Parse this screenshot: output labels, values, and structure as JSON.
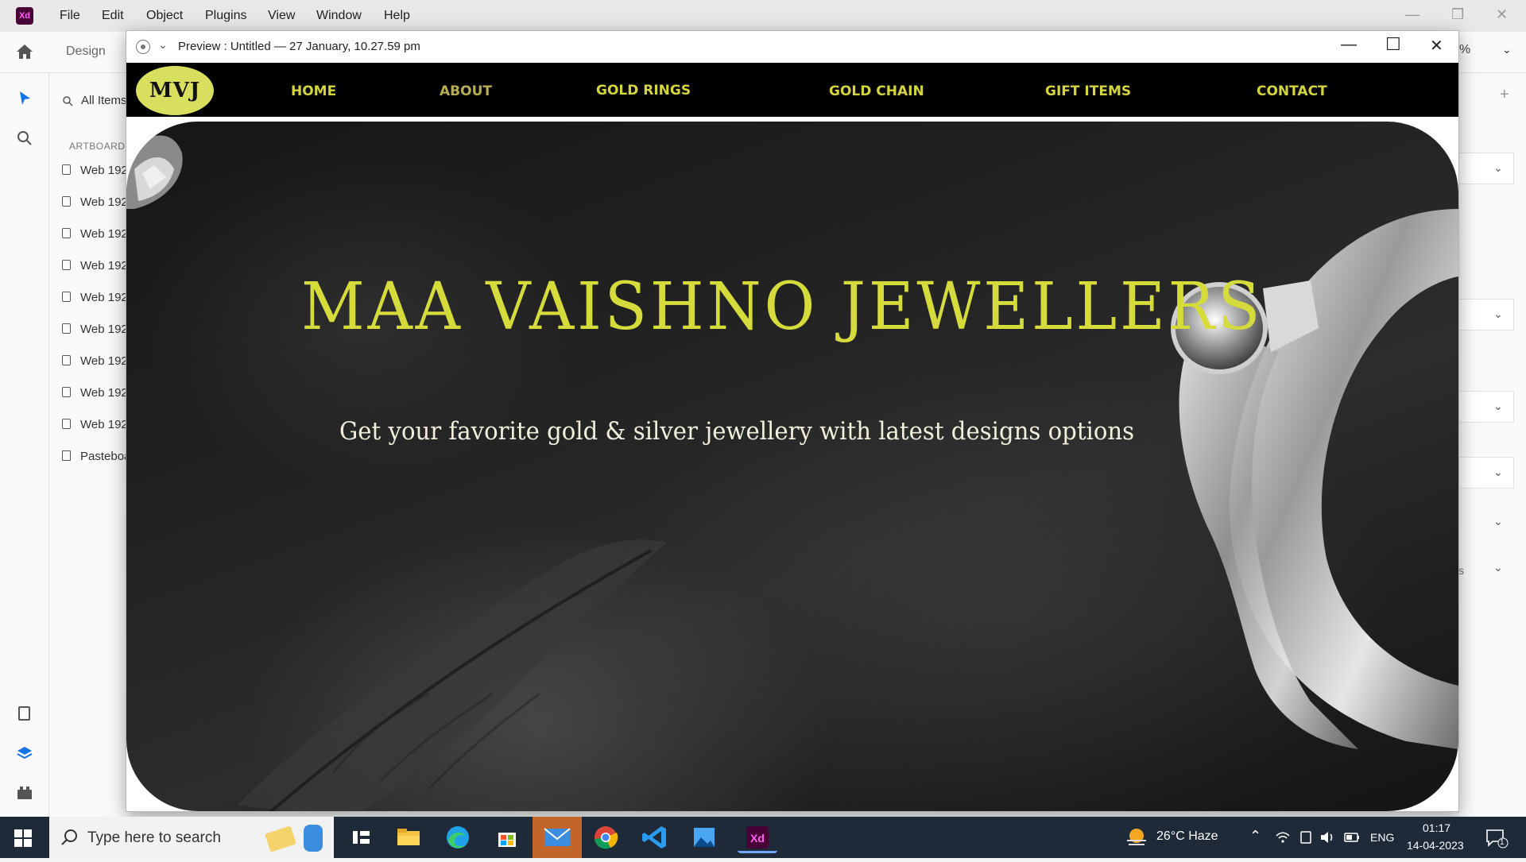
{
  "app": {
    "logo": "Xd",
    "menu": [
      "File",
      "Edit",
      "Object",
      "Plugins",
      "View",
      "Window",
      "Help"
    ],
    "toolbar": {
      "design_tab": "Design",
      "zoom_fragment": "%"
    }
  },
  "layers": {
    "search_label": "All Items",
    "heading": "ARTBOARD",
    "artboards": [
      "Web 192",
      "Web 192",
      "Web 192",
      "Web 192",
      "Web 192",
      "Web 192",
      "Web 192",
      "Web 192",
      "Web 192"
    ],
    "pasteboard": "Pasteboa"
  },
  "props_panel": {
    "fragment": "s"
  },
  "preview": {
    "title": "Preview : Untitled — 27 January, 10.27.59 pm"
  },
  "site": {
    "logo": "MVJ",
    "nav": [
      "HOME",
      "ABOUT",
      "GOLD RINGS",
      "GOLD CHAIN",
      "GIFT ITEMS",
      "CONTACT"
    ],
    "hero_title": "MAA VAISHNO JEWELLERS",
    "hero_subtitle": "Get your favorite gold & silver jewellery with latest designs options",
    "colors": {
      "nav_bg": "#000000",
      "accent": "#d6db3c",
      "logo_bg": "#d8df5e"
    }
  },
  "taskbar": {
    "search_placeholder": "Type here to search",
    "weather": "26°C  Haze",
    "language": "ENG",
    "time": "01:17",
    "date": "14-04-2023",
    "notification_count": "1",
    "apps": [
      "widgets",
      "task-view",
      "file-explorer",
      "edge",
      "store",
      "mail",
      "chrome",
      "vscode",
      "photos",
      "xd"
    ]
  }
}
